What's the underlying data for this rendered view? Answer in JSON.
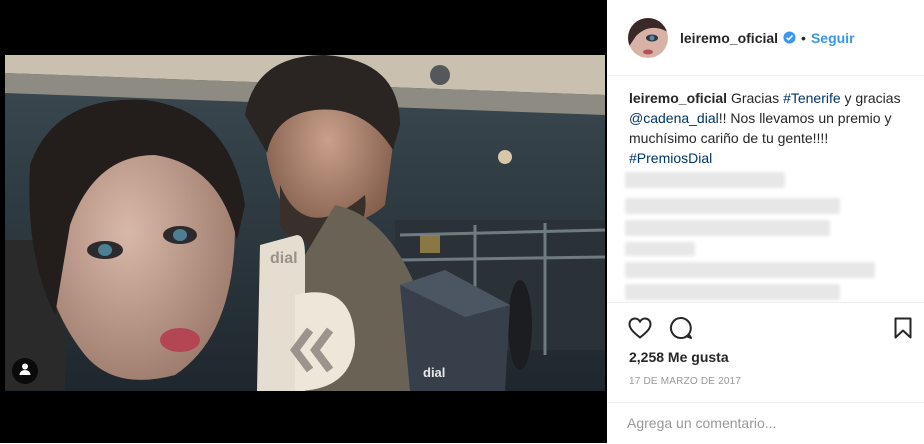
{
  "post": {
    "username": "leiremo_oficial",
    "follow_label": "Seguir",
    "separator": "•",
    "caption_parts": {
      "t1": "Gracias ",
      "tag_tenerife": "#Tenerife",
      "t2": " y gracias ",
      "mention_dial": "@cadena_dial",
      "t3": "!! Nos llevamos un premio y muchísimo cariño de tu gente!!!! ",
      "tag_premios": "#PremiosDial"
    },
    "likes": "2,258 Me gusta",
    "date": "17 de marzo de 2017",
    "comment_placeholder": "Agrega un comentario...",
    "photo_texts": {
      "trophy_brand": "dial",
      "box_brand": "dial"
    }
  },
  "icons": [
    "user-tag-icon",
    "verified-badge-icon",
    "heart-icon",
    "comment-icon",
    "bookmark-icon"
  ],
  "colors": {
    "link_blue": "#3897f0",
    "hashtag": "#003569",
    "text": "#262626",
    "muted": "#999999",
    "divider": "#efefef"
  }
}
